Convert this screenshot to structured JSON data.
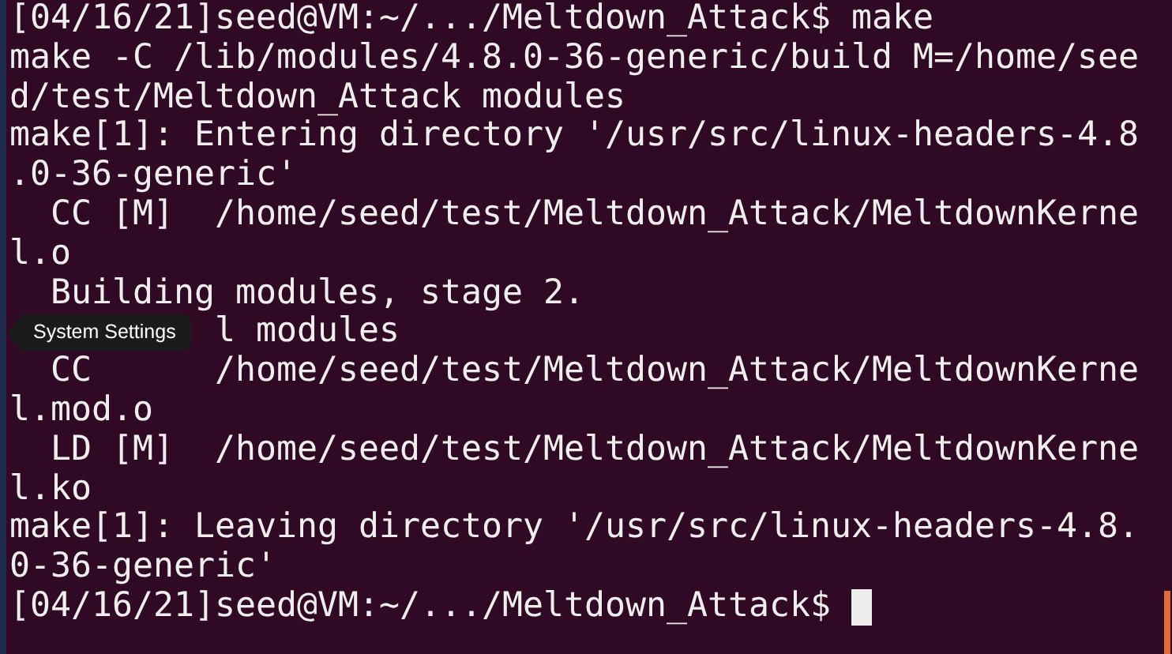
{
  "terminal": {
    "lines": [
      "[04/16/21]seed@VM:~/.../Meltdown_Attack$ make",
      "make -C /lib/modules/4.8.0-36-generic/build M=/home/see",
      "d/test/Meltdown_Attack modules",
      "make[1]: Entering directory '/usr/src/linux-headers-4.8",
      ".0-36-generic'",
      "  CC [M]  /home/seed/test/Meltdown_Attack/MeltdownKerne",
      "l.o",
      "  Building modules, stage 2.",
      "l modules",
      "  CC      /home/seed/test/Meltdown_Attack/MeltdownKerne",
      "l.mod.o",
      "  LD [M]  /home/seed/test/Meltdown_Attack/MeltdownKerne",
      "l.ko",
      "make[1]: Leaving directory '/usr/src/linux-headers-4.8.",
      "0-36-generic'"
    ],
    "prompt": "[04/16/21]seed@VM:~/.../Meltdown_Attack$ "
  },
  "tooltip": {
    "text": "System Settings"
  }
}
